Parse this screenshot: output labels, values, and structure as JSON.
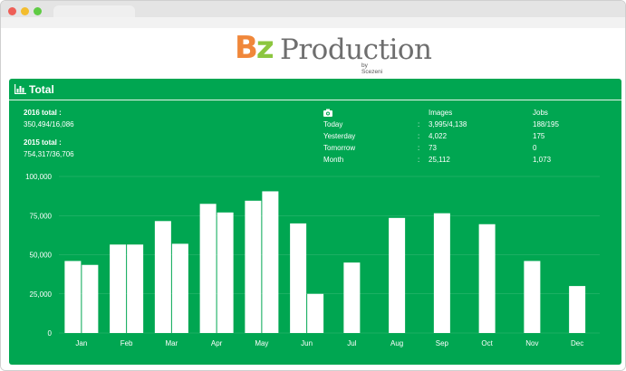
{
  "logo": {
    "bz": "Bz",
    "b": "B",
    "z": "z",
    "production": "Production",
    "by": "by Scezeni"
  },
  "panel": {
    "title": "Total",
    "icon": "bar-chart-icon"
  },
  "summary": [
    {
      "label": "2016 total :",
      "value": "350,494/16,086"
    },
    {
      "label": "2015 total :",
      "value": "754,317/36,706"
    }
  ],
  "stats": {
    "icon": "camera-icon",
    "headers": {
      "images": "Images",
      "jobs": "Jobs"
    },
    "rows": [
      {
        "label": "Today",
        "sep": ":",
        "images": "3,995/4,138",
        "jobs": "188/195"
      },
      {
        "label": "Yesterday",
        "sep": ":",
        "images": "4,022",
        "jobs": "175"
      },
      {
        "label": "Tomorrow",
        "sep": ":",
        "images": "73",
        "jobs": "0"
      },
      {
        "label": "Month",
        "sep": ":",
        "images": "25,112",
        "jobs": "1,073"
      }
    ]
  },
  "chart_data": {
    "type": "bar",
    "categories": [
      "Jan",
      "Feb",
      "Mar",
      "Apr",
      "May",
      "Jun",
      "Jul",
      "Aug",
      "Sep",
      "Oct",
      "Nov",
      "Dec"
    ],
    "series": [
      {
        "values": [
          46000,
          56500,
          71500,
          82500,
          84500,
          70000,
          45000,
          73500,
          76500,
          69500,
          46000,
          30000
        ]
      },
      {
        "values": [
          43500,
          56500,
          57000,
          77000,
          90500,
          25000,
          null,
          null,
          null,
          null,
          null,
          null
        ]
      }
    ],
    "ylim": [
      0,
      100000
    ],
    "yticks": [
      "0",
      "25,000",
      "50,000",
      "75,000",
      "100,000"
    ],
    "ytick_values": [
      0,
      25000,
      50000,
      75000,
      100000
    ],
    "grid": true,
    "colors": {
      "bar": "#ffffff",
      "background": "#00a651",
      "text": "#ffffff"
    }
  }
}
